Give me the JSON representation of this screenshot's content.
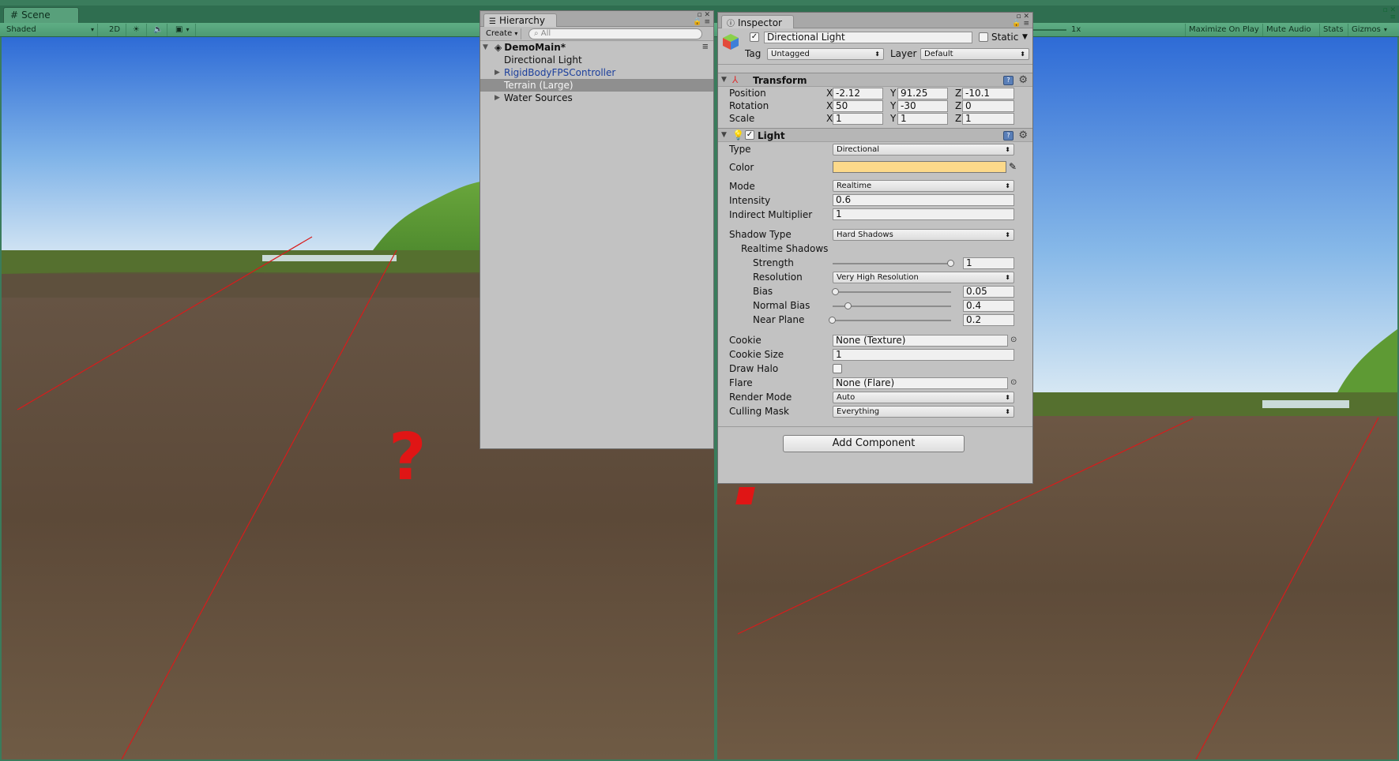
{
  "scene": {
    "tab_label": "Scene",
    "toolbar": {
      "shading_mode": "Shaded",
      "mode_2d": "2D",
      "scale_value": "1x",
      "maximize_on_play": "Maximize On Play",
      "mute_audio": "Mute Audio",
      "stats": "Stats",
      "gizmos": "Gizmos"
    },
    "overlay_mark": "?"
  },
  "hierarchy": {
    "tab_label": "Hierarchy",
    "create_label": "Create",
    "search_placeholder": "All",
    "scene_name": "DemoMain*",
    "items": [
      {
        "label": "Directional Light",
        "foldable": false,
        "prefab": false,
        "selected": false
      },
      {
        "label": "RigidBodyFPSController",
        "foldable": true,
        "prefab": true,
        "selected": false
      },
      {
        "label": "Terrain (Large)",
        "foldable": false,
        "prefab": false,
        "selected": true
      },
      {
        "label": "Water Sources",
        "foldable": true,
        "prefab": false,
        "selected": false
      }
    ]
  },
  "inspector": {
    "tab_label": "Inspector",
    "object_name": "Directional Light",
    "active": true,
    "static_label": "Static",
    "static": false,
    "tag_label": "Tag",
    "tag_value": "Untagged",
    "layer_label": "Layer",
    "layer_value": "Default",
    "transform": {
      "title": "Transform",
      "rows": [
        {
          "label": "Position",
          "x": "-2.12",
          "y": "91.25",
          "z": "-10.1"
        },
        {
          "label": "Rotation",
          "x": "50",
          "y": "-30",
          "z": "0"
        },
        {
          "label": "Scale",
          "x": "1",
          "y": "1",
          "z": "1"
        }
      ],
      "axis_x": "X",
      "axis_y": "Y",
      "axis_z": "Z"
    },
    "light": {
      "title": "Light",
      "enabled": true,
      "color_value": "#fcd98a",
      "fields": {
        "type_label": "Type",
        "type_value": "Directional",
        "color_label": "Color",
        "mode_label": "Mode",
        "mode_value": "Realtime",
        "intensity_label": "Intensity",
        "intensity_value": "0.6",
        "indirect_label": "Indirect Multiplier",
        "indirect_value": "1",
        "shadow_type_label": "Shadow Type",
        "shadow_type_value": "Hard Shadows",
        "realtime_shadows_label": "Realtime Shadows",
        "strength_label": "Strength",
        "strength_value": "1",
        "strength_fraction": 1.0,
        "resolution_label": "Resolution",
        "resolution_value": "Very High Resolution",
        "bias_label": "Bias",
        "bias_value": "0.05",
        "bias_fraction": 0.025,
        "normal_bias_label": "Normal Bias",
        "normal_bias_value": "0.4",
        "normal_bias_fraction": 0.13,
        "near_plane_label": "Near Plane",
        "near_plane_value": "0.2",
        "near_plane_fraction": 0.0,
        "cookie_label": "Cookie",
        "cookie_value": "None (Texture)",
        "cookie_size_label": "Cookie Size",
        "cookie_size_value": "1",
        "draw_halo_label": "Draw Halo",
        "draw_halo": false,
        "flare_label": "Flare",
        "flare_value": "None (Flare)",
        "render_mode_label": "Render Mode",
        "render_mode_value": "Auto",
        "culling_mask_label": "Culling Mask",
        "culling_mask_value": "Everything"
      }
    },
    "add_component_label": "Add Component"
  },
  "colors": {
    "editor_frame": "#3a7c5c",
    "sky_top": "#2f6fd9",
    "terrain": "#6e5a44",
    "grass": "#5d9a35",
    "selection": "#8f8f8f",
    "mark_red": "#e01515"
  }
}
